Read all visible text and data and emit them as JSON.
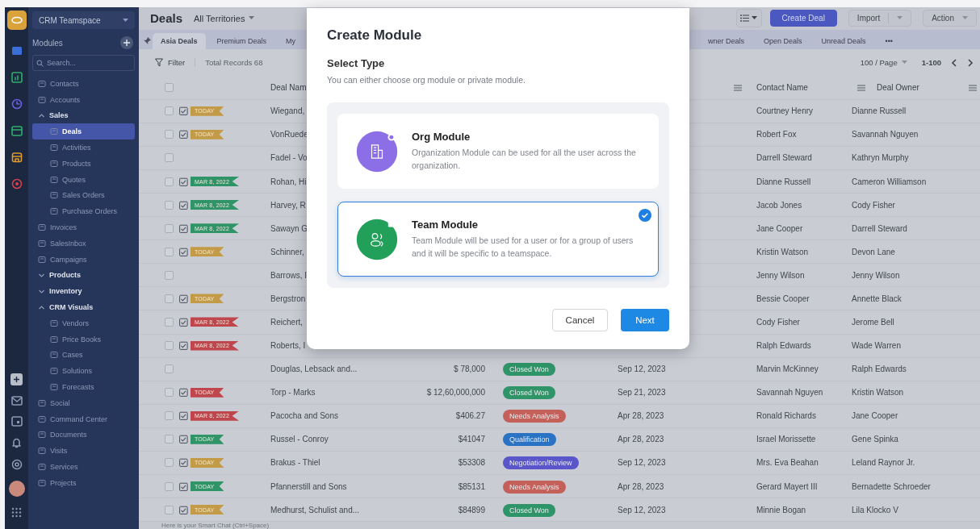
{
  "workspace": {
    "name": "CRM Teamspace"
  },
  "sidebar": {
    "heading": "Modules",
    "search_placeholder": "Search...",
    "items": [
      {
        "label": "Contacts",
        "selected": false
      },
      {
        "label": "Accounts",
        "selected": false
      },
      {
        "label": "Sales",
        "selected": false,
        "expanded": true,
        "children": [
          {
            "label": "Deals",
            "selected": true
          },
          {
            "label": "Activities",
            "selected": false
          },
          {
            "label": "Products",
            "selected": false
          },
          {
            "label": "Quotes",
            "selected": false
          },
          {
            "label": "Sales Orders",
            "selected": false
          },
          {
            "label": "Purchase Orders",
            "selected": false
          }
        ]
      },
      {
        "label": "Invoices",
        "selected": false
      },
      {
        "label": "SalesInbox",
        "selected": false
      },
      {
        "label": "Campaigns",
        "selected": false
      },
      {
        "label": "Products",
        "selected": false,
        "expanded": false
      },
      {
        "label": "Inventory",
        "selected": false,
        "expanded": false
      },
      {
        "label": "CRM Visuals",
        "selected": false,
        "expanded": true,
        "children": [
          {
            "label": "Vendors",
            "selected": false
          },
          {
            "label": "Price Books",
            "selected": false
          },
          {
            "label": "Cases",
            "selected": false
          },
          {
            "label": "Solutions",
            "selected": false
          },
          {
            "label": "Forecasts",
            "selected": false
          }
        ]
      },
      {
        "label": "Social",
        "selected": false
      },
      {
        "label": "Command Center",
        "selected": false
      },
      {
        "label": "Documents",
        "selected": false
      },
      {
        "label": "Visits",
        "selected": false
      },
      {
        "label": "Services",
        "selected": false
      },
      {
        "label": "Projects",
        "selected": false
      }
    ]
  },
  "header": {
    "title": "Deals",
    "territory": "All Territories",
    "buttons": [
      {
        "label": "Create Deal",
        "kind": "primary"
      },
      {
        "label": "Import",
        "kind": "split"
      },
      {
        "label": "Action",
        "kind": "dropdown"
      }
    ]
  },
  "tabs": {
    "left": [
      {
        "label": "Asia Deals",
        "selected": true
      },
      {
        "label": "Premium Deals",
        "selected": false
      },
      {
        "label": "My",
        "selected": false
      }
    ],
    "right": [
      {
        "label": "wner Deals",
        "selected": false
      },
      {
        "label": "Open Deals",
        "selected": false
      },
      {
        "label": "Unread Deals",
        "selected": false
      }
    ],
    "more": "•••"
  },
  "toolbar": {
    "filter": "Filter",
    "total": "Total Records 68",
    "page_size": "100 / Page",
    "range": "1-100"
  },
  "table": {
    "select_all": {
      "checked": false
    },
    "columns": [
      "Deal Nam",
      "Contact Name",
      "Deal Owner"
    ],
    "rows": [
      {
        "checked": false,
        "tag": {
          "label": "TODAY",
          "color": "#c39a45"
        },
        "deal_name": "Wiegand,",
        "contact_name": "Courtney Henry",
        "deal_owner": "Dianne Russell"
      },
      {
        "checked": false,
        "tag": {
          "label": "TODAY",
          "color": "#c39a45"
        },
        "deal_name": "VonRuede",
        "contact_name": "Robert Fox",
        "deal_owner": "Savannah Nguyen"
      },
      {
        "checked": false,
        "deal_name": "Fadel - Vo",
        "contact_name": "Darrell Steward",
        "deal_owner": "Kathryn Murphy"
      },
      {
        "checked": false,
        "tag": {
          "label": "MAR 8, 2022",
          "color": "#2f9468"
        },
        "deal_name": "Rohan, Hi",
        "contact_name": "Dianne Russell",
        "deal_owner": "Cameron Williamson"
      },
      {
        "checked": false,
        "tag": {
          "label": "MAR 8, 2022",
          "color": "#2f9468"
        },
        "deal_name": "Harvey, R",
        "contact_name": "Jacob Jones",
        "deal_owner": "Cody Fisher"
      },
      {
        "checked": false,
        "tag": {
          "label": "MAR 8, 2022",
          "color": "#2f9468"
        },
        "deal_name": "Sawayn G",
        "contact_name": "Jane Cooper",
        "deal_owner": "Darrell Steward"
      },
      {
        "checked": false,
        "tag": {
          "label": "TODAY",
          "color": "#c39a45"
        },
        "deal_name": "Schinner,",
        "contact_name": "Kristin Watson",
        "deal_owner": "Devon Lane"
      },
      {
        "checked": false,
        "deal_name": "Barrows, I",
        "contact_name": "Jenny Wilson",
        "deal_owner": "Jenny Wilson"
      },
      {
        "checked": false,
        "tag": {
          "label": "TODAY",
          "color": "#c39a45"
        },
        "deal_name": "Bergstron",
        "contact_name": "Bessie Cooper",
        "deal_owner": "Annette Black"
      },
      {
        "checked": false,
        "tag": {
          "label": "MAR 8, 2022",
          "color": "#c0464e"
        },
        "deal_name": "Reichert,",
        "contact_name": "Cody Fisher",
        "deal_owner": "Jerome Bell"
      },
      {
        "checked": false,
        "tag": {
          "label": "MAR 8, 2022",
          "color": "#c0464e"
        },
        "deal_name": "Roberts, I",
        "contact_name": "Ralph Edwards",
        "deal_owner": "Wade Warren"
      },
      {
        "checked": false,
        "deal_name": "Douglas, Lebsack and...",
        "amount": "$ 78,000",
        "stage": {
          "label": "Closed Won",
          "color": "#2f9468"
        },
        "closing_date": "Sep 12, 2023",
        "contact_name": "Marvin McKinney",
        "deal_owner": "Ralph Edwards"
      },
      {
        "checked": false,
        "tag": {
          "label": "TODAY",
          "color": "#c0464e"
        },
        "deal_name": "Torp - Marks",
        "amount": "$ 12,60,000,000",
        "stage": {
          "label": "Closed Won",
          "color": "#2f9468"
        },
        "closing_date": "Sep 21, 2023",
        "contact_name": "Savannah Nguyen",
        "deal_owner": "Kristin Watson"
      },
      {
        "checked": false,
        "tag": {
          "label": "MAR 8, 2022",
          "color": "#c0464e"
        },
        "deal_name": "Pacocha and Sons",
        "amount": "$406.27",
        "stage": {
          "label": "Needs Analysis",
          "color": "#c4605a"
        },
        "closing_date": "Apr 28, 2023",
        "contact_name": "Ronald Richards",
        "deal_owner": "Jane Cooper"
      },
      {
        "checked": false,
        "tag": {
          "label": "TODAY",
          "color": "#2f9468"
        },
        "deal_name": "Russel - Conroy",
        "amount": "$41047",
        "stage": {
          "label": "Qualification",
          "color": "#2a72c4"
        },
        "closing_date": "Apr 28, 2023",
        "contact_name": "Israel Morissette",
        "deal_owner": "Gene Spinka"
      },
      {
        "checked": false,
        "tag": {
          "label": "TODAY",
          "color": "#c39a45"
        },
        "deal_name": "Brakus - Thiel",
        "amount": "$53308",
        "stage": {
          "label": "Negotiation/Review",
          "color": "#5a55c8"
        },
        "closing_date": "Sep 12, 2023",
        "contact_name": "Mrs. Eva Beahan",
        "deal_owner": "Leland Raynor Jr."
      },
      {
        "checked": false,
        "tag": {
          "label": "TODAY",
          "color": "#2f9468"
        },
        "deal_name": "Pfannerstill and Sons",
        "amount": "$85131",
        "stage": {
          "label": "Needs Analysis",
          "color": "#c4605a"
        },
        "closing_date": "Apr 28, 2023",
        "contact_name": "Gerard Mayert III",
        "deal_owner": "Bernadette Schroeder"
      },
      {
        "checked": false,
        "tag": {
          "label": "TODAY",
          "color": "#c39a45"
        },
        "deal_name": "Medhurst, Schulist and...",
        "amount": "$84899",
        "stage": {
          "label": "Closed Won",
          "color": "#2f9468"
        },
        "closing_date": "Sep 12, 2023",
        "contact_name": "Minnie Bogan",
        "deal_owner": "Lila Klocko V"
      }
    ]
  },
  "footer": {
    "hint": "Here is your Smart Chat (Ctrl+Space)"
  },
  "modal": {
    "title": "Create Module",
    "section": "Select Type",
    "subtitle": "You can either choose org module or private module.",
    "options": [
      {
        "kind": "org",
        "title": "Org Module",
        "description": "Organization Module can be used for all the user across the organization.",
        "color": "#8c6ee6",
        "selected": false
      },
      {
        "kind": "team",
        "title": "Team Module",
        "description": "Team Module will be used for a user or for a group of users and it will be specific to a teamspace.",
        "color": "#22a05a",
        "selected": true
      }
    ],
    "buttons": [
      {
        "label": "Cancel",
        "kind": "secondary"
      },
      {
        "label": "Next",
        "kind": "primary"
      }
    ]
  }
}
